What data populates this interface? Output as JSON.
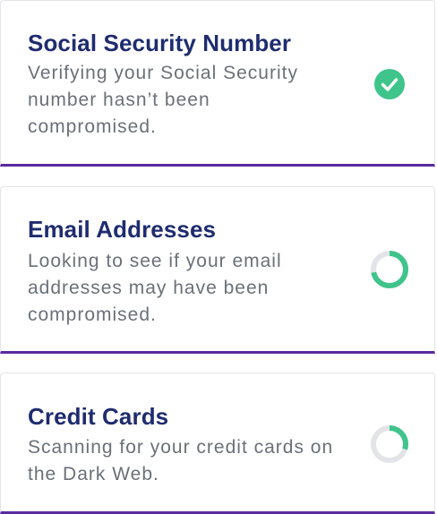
{
  "colors": {
    "title": "#1f2c6e",
    "description": "#6b7078",
    "accent_border": "#5b2a9e",
    "success": "#3fc48b",
    "track": "#e2e4e8"
  },
  "cards": [
    {
      "title": "Social Security Number",
      "description": "Verifying your Social Security number hasn’t been compromised.",
      "status": "complete",
      "icon": "check-circle-icon"
    },
    {
      "title": "Email Addresses",
      "description": "Looking to see if your email addresses may have been compromised.",
      "status": "in-progress",
      "progress": 0.72,
      "icon": "progress-ring-icon"
    },
    {
      "title": "Credit Cards",
      "description": "Scanning for your credit cards on the Dark Web.",
      "status": "in-progress",
      "progress": 0.3,
      "icon": "progress-ring-icon"
    }
  ]
}
